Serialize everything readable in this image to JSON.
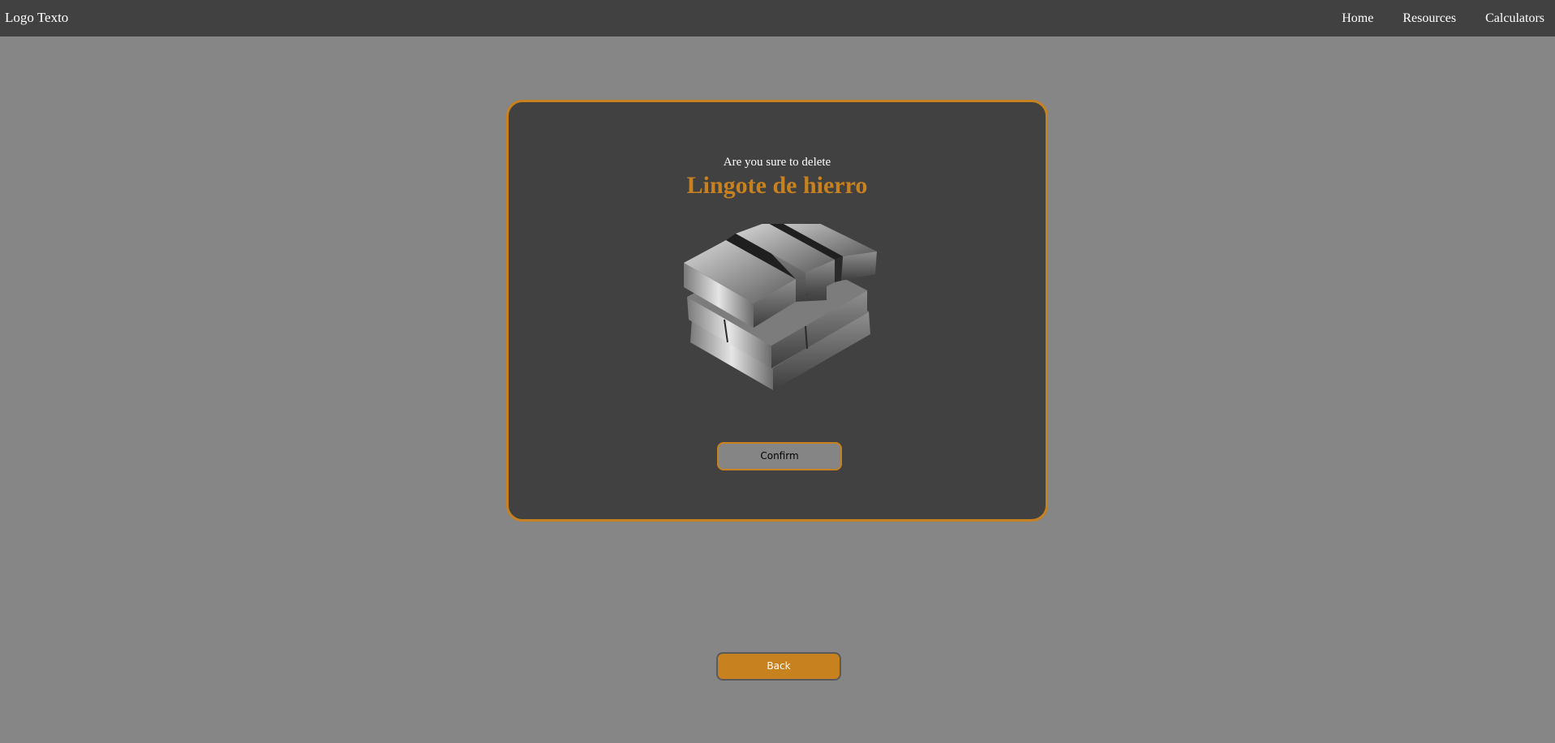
{
  "navbar": {
    "logo": "Logo Texto",
    "links": [
      {
        "label": "Home"
      },
      {
        "label": "Resources"
      },
      {
        "label": "Calculators"
      }
    ]
  },
  "dialog": {
    "prompt": "Are you sure to delete",
    "item_name": "Lingote de hierro",
    "image_icon": "iron-ingot-stack",
    "confirm_label": "Confirm"
  },
  "back_label": "Back",
  "colors": {
    "accent": "#c8811f",
    "page_bg": "#868686",
    "panel_bg": "#414141"
  }
}
